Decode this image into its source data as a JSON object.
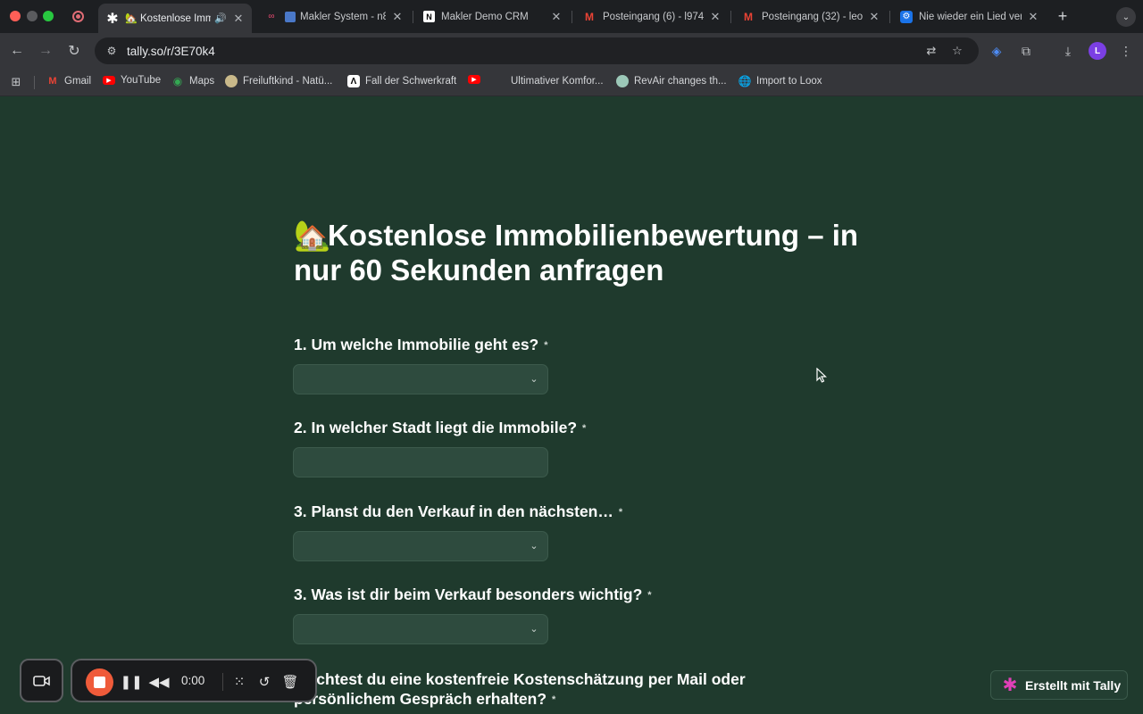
{
  "browser": {
    "tabs": [
      {
        "title": "Kostenlose Imm",
        "icon": "tally-asterisk-icon",
        "active": true
      },
      {
        "title": "Makler System - n8",
        "icon": "n8n-icon"
      },
      {
        "title": "Makler Demo CRM",
        "icon": "notion-icon"
      },
      {
        "title": "Posteingang (6) - l974",
        "icon": "gmail-icon"
      },
      {
        "title": "Posteingang (32) - leo",
        "icon": "gmail-icon"
      },
      {
        "title": "Nie wieder ein Lied ver",
        "icon": "gear-icon"
      }
    ],
    "address": "tally.so/r/3E70k4",
    "profile_initial": "L",
    "bookmarks": [
      {
        "label": "Gmail",
        "icon": "gmail-icon"
      },
      {
        "label": "YouTube",
        "icon": "youtube-icon"
      },
      {
        "label": "Maps",
        "icon": "maps-icon"
      },
      {
        "label": "Freiluftkind - Natü...",
        "icon": "freiluftkind-icon"
      },
      {
        "label": "Fall der Schwerkraft",
        "icon": "artstation-icon"
      },
      {
        "label": "",
        "icon": "youtube-icon"
      },
      {
        "label": "Ultimativer Komfor...",
        "icon": "blank-icon"
      },
      {
        "label": "RevAir changes th...",
        "icon": "revair-icon"
      },
      {
        "label": "Import to Loox",
        "icon": "globe-icon"
      }
    ]
  },
  "form": {
    "title": "Kostenlose Immobilienbewertung – in nur 60 Sekunden anfragen",
    "required_mark": "*",
    "questions": [
      {
        "label": "1. Um welche Immobilie geht es?",
        "type": "select"
      },
      {
        "label": "2. In welcher Stadt liegt die Immobile?",
        "type": "text"
      },
      {
        "label": "3. Planst du den Verkauf in den nächsten…",
        "type": "select"
      },
      {
        "label": "3. Was ist dir beim Verkauf besonders wichtig?",
        "type": "select"
      },
      {
        "label": "Möchtest du eine kostenfreie Kostenschätzung per Mail oder persönlichem Gespräch erhalten?",
        "type": "choice"
      }
    ],
    "badge": "Erstellt mit Tally"
  },
  "recorder": {
    "time": "0:00"
  }
}
